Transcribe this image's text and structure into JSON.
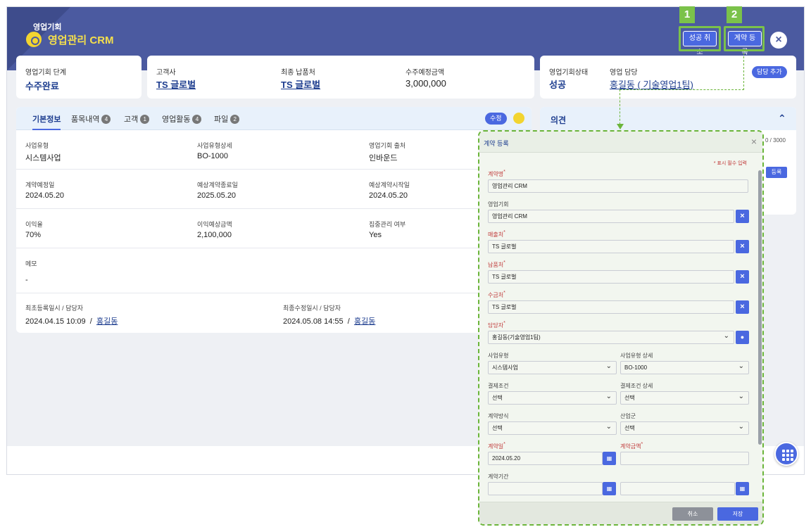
{
  "header": {
    "subtitle": "영업기회",
    "title": "영업관리 CRM",
    "btn_cancel_success": "성공 취소",
    "btn_contract": "계약 등록",
    "close": "×",
    "num1": "1",
    "num2": "2"
  },
  "summary": {
    "stage_label": "영업기회 단계",
    "stage_value": "수주완료",
    "customer_label": "고객사",
    "customer_value": "TS 글로벌",
    "delivery_label": "최종 납품처",
    "delivery_value": "TS 글로벌",
    "amount_label": "수주예정금액",
    "amount_value": "3,000,000",
    "status_label": "영업기회상태",
    "status_value": "성공",
    "owner_label": "영업 담당",
    "owner_value": "홍길동 ( 기술영업1팀)",
    "add_owner": "담당 추가"
  },
  "tabs": [
    {
      "label": "기본정보"
    },
    {
      "label": "품목내역",
      "count": "4"
    },
    {
      "label": "고객",
      "count": "1"
    },
    {
      "label": "영업활동",
      "count": "4"
    },
    {
      "label": "파일",
      "count": "2"
    }
  ],
  "edit_label": "수정",
  "info": {
    "biz_type_l": "사업유형",
    "biz_type_v": "시스템사업",
    "biz_detail_l": "사업유형상세",
    "biz_detail_v": "BO-1000",
    "source_l": "영업기회 출처",
    "source_v": "인바운드",
    "plan_date_l": "계약예정일",
    "plan_date_v": "2024.05.20",
    "end_date_l": "예상계약종료일",
    "end_date_v": "2025.05.20",
    "start_date_l": "예상계약시작일",
    "start_date_v": "2024.05.20",
    "margin_l": "이익율",
    "margin_v": "70%",
    "profit_l": "이익예상금액",
    "profit_v": "2,100,000",
    "focus_l": "집중관리 여부",
    "focus_v": "Yes",
    "memo_l": "메모",
    "memo_v": "-",
    "created_l": "최초등록일시 / 담당자",
    "created_v": "2024.04.15 10:09",
    "created_sep": "/",
    "created_user": "홍길동",
    "modified_l": "최종수정일시 / 담당자",
    "modified_v": "2024.05.08 14:55",
    "modified_sep": "/",
    "modified_user": "홍길동"
  },
  "opinion": {
    "title": "의견",
    "counter": "0 / 3000",
    "register": "등록"
  },
  "modal": {
    "title": "계약 등록",
    "close": "×",
    "req_note": "* 표시 필수 입력",
    "contract_name_l": "계약명",
    "contract_name_v": "영업관리 CRM",
    "opp_l": "영업기회",
    "opp_v": "영업관리 CRM",
    "sales_l": "매출처",
    "sales_v": "TS 글로벌",
    "deliv_l": "납품처",
    "deliv_v": "TS 글로벌",
    "payer_l": "수금처",
    "payer_v": "TS 글로벌",
    "manager_l": "담당자",
    "manager_v": "홍길동(기술영업1팀)",
    "btype_l": "사업유형",
    "btype_v": "시스템사업",
    "bdetail_l": "사업유형 상세",
    "bdetail_v": "BO-1000",
    "pay_l": "결제조건",
    "pay_v": "선택",
    "paydetail_l": "결제조건 상세",
    "paydetail_v": "선택",
    "method_l": "계약방식",
    "method_v": "선택",
    "industry_l": "산업군",
    "industry_v": "선택",
    "cdate_l": "계약일",
    "cdate_v": "2024.05.20",
    "camount_l": "계약금액",
    "camount_v": "",
    "period_l": "계약기간",
    "cancel": "취소",
    "save": "저장",
    "x": "×"
  }
}
